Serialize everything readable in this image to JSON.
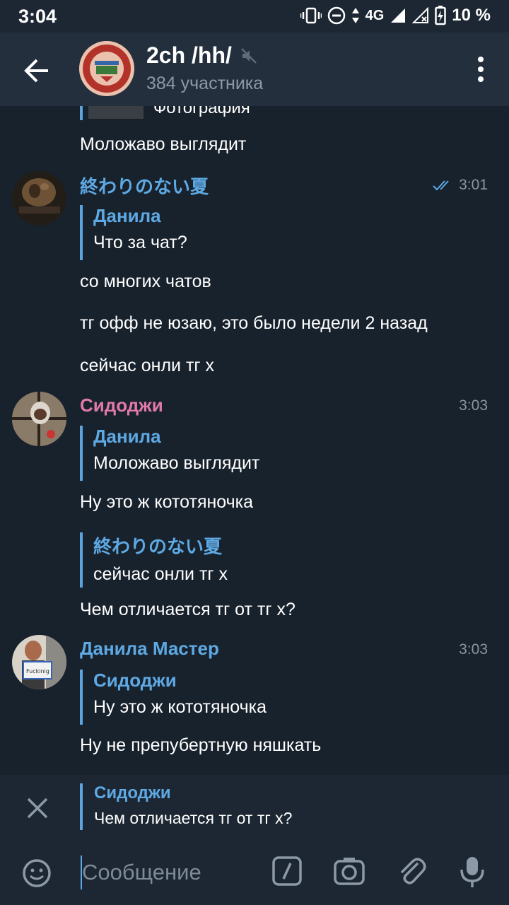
{
  "status_bar": {
    "time": "3:04",
    "network": "4G",
    "battery": "10 %"
  },
  "header": {
    "title": "2ch /hh/",
    "subtitle": "384 участника",
    "muted": true
  },
  "colors": {
    "accent": "#5ea9e3",
    "sender_pink": "#e27aa9",
    "background": "#18222d",
    "header": "#242f3d"
  },
  "messages": {
    "top_partial": {
      "reply_text": "Фотография",
      "text": "Моложаво выглядит"
    },
    "group1": {
      "sender": "終わりのない夏",
      "time": "3:01",
      "read_status": "double-check",
      "reply": {
        "name": "Данила",
        "text": "Что за чат?"
      },
      "lines": [
        "со многих чатов",
        "тг офф не юзаю, это было недели 2 назад",
        "сейчас онли тг х"
      ]
    },
    "group2": {
      "sender": "Сидоджи",
      "time": "3:03",
      "reply1": {
        "name": "Данила",
        "text": "Моложаво выглядит"
      },
      "line1": "Ну это ж кототяночка",
      "reply2": {
        "name": "終わりのない夏",
        "text": "сейчас онли тг х"
      },
      "line2": "Чем отличается тг от тг х?"
    },
    "group3": {
      "sender": "Данила Мастер",
      "time": "3:03",
      "reply": {
        "name": "Сидоджи",
        "text": "Ну это ж кототяночка"
      },
      "line": "Ну не препубертную няшкать",
      "avatar_sign_text": "Fuckinig"
    }
  },
  "reply_preview": {
    "name": "Сидоджи",
    "text": "Чем отличается тг от тг х?"
  },
  "composer": {
    "placeholder": "Сообщение"
  },
  "icons": [
    "arrow-left-icon",
    "mute-icon",
    "more-vert-icon",
    "double-check-icon",
    "close-icon",
    "emoji-icon",
    "slash-command-icon",
    "camera-icon",
    "paperclip-icon",
    "microphone-icon"
  ]
}
